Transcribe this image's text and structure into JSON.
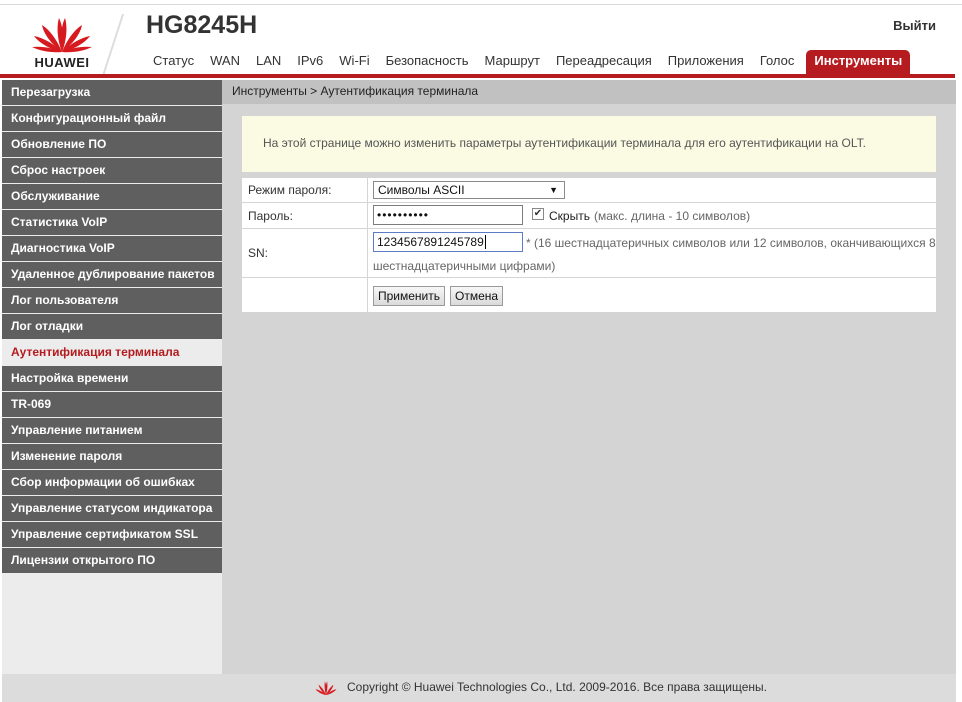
{
  "brand": {
    "name": "HUAWEI",
    "model": "HG8245H",
    "logout": "Выйти",
    "accent_color": "#b51b1f",
    "logo_icon": "huawei-petals-icon"
  },
  "nav": {
    "items": [
      {
        "label": "Статус",
        "active": false
      },
      {
        "label": "WAN",
        "active": false
      },
      {
        "label": "LAN",
        "active": false
      },
      {
        "label": "IPv6",
        "active": false
      },
      {
        "label": "Wi-Fi",
        "active": false
      },
      {
        "label": "Безопасность",
        "active": false
      },
      {
        "label": "Маршрут",
        "active": false
      },
      {
        "label": "Переадресация",
        "active": false
      },
      {
        "label": "Приложения",
        "active": false
      },
      {
        "label": "Голос",
        "active": false
      },
      {
        "label": "Инструменты",
        "active": true
      }
    ]
  },
  "sidebar": {
    "items": [
      {
        "label": "Перезагрузка",
        "active": false
      },
      {
        "label": "Конфигурационный файл",
        "active": false
      },
      {
        "label": "Обновление ПО",
        "active": false
      },
      {
        "label": "Сброс настроек",
        "active": false
      },
      {
        "label": "Обслуживание",
        "active": false
      },
      {
        "label": "Статистика VoIP",
        "active": false
      },
      {
        "label": "Диагностика VoIP",
        "active": false
      },
      {
        "label": "Удаленное дублирование пакетов",
        "active": false
      },
      {
        "label": "Лог пользователя",
        "active": false
      },
      {
        "label": "Лог отладки",
        "active": false
      },
      {
        "label": "Аутентификация терминала",
        "active": true
      },
      {
        "label": "Настройка времени",
        "active": false
      },
      {
        "label": "TR-069",
        "active": false
      },
      {
        "label": "Управление питанием",
        "active": false
      },
      {
        "label": "Изменение пароля",
        "active": false
      },
      {
        "label": "Сбор информации об ошибках",
        "active": false
      },
      {
        "label": "Управление статусом индикатора",
        "active": false
      },
      {
        "label": "Управление сертификатом SSL",
        "active": false
      },
      {
        "label": "Лицензии открытого ПО",
        "active": false
      }
    ]
  },
  "main": {
    "breadcrumb": "Инструменты > Аутентификация терминала",
    "info": "На этой странице можно изменить параметры аутентификации терминала для его аутентификации на OLT.",
    "form": {
      "password_mode_label": "Режим пароля:",
      "password_mode_value": "Символы ASCII",
      "password_label": "Пароль:",
      "password_value": "••••••••••",
      "hide_checked": true,
      "hide_label": "Скрыть",
      "password_hint": "(макс. длина - 10 символов)",
      "sn_label": "SN:",
      "sn_value": "1234567891245789",
      "sn_hint_line1": "* (16 шестнадцатеричных символов или 12 символов, оканчивающихся 8",
      "sn_hint_line2": "шестнадцатеричными цифрами)"
    },
    "buttons": {
      "apply": "Применить",
      "cancel": "Отмена"
    }
  },
  "footer": {
    "copyright": "Copyright © Huawei Technologies Co., Ltd. 2009-2016. Все права защищены."
  }
}
